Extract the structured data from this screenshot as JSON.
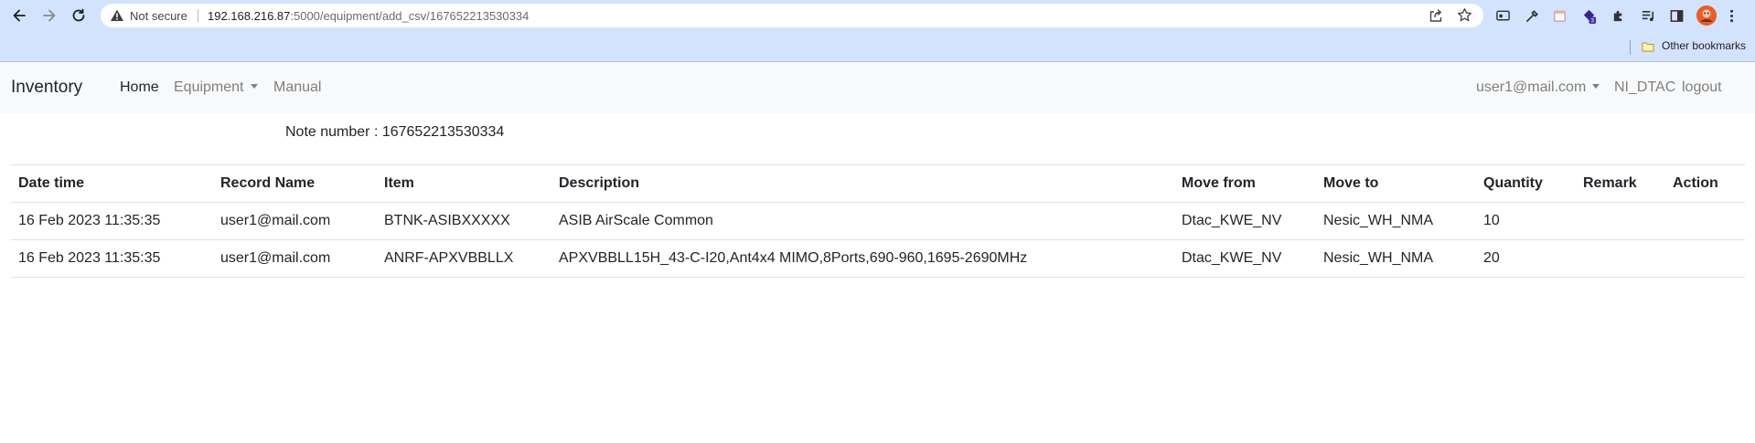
{
  "browser": {
    "security_label": "Not secure",
    "url_host": "192.168.216.87",
    "url_rest": ":5000/equipment/add_csv/167652213530334",
    "extension_badge": "3",
    "bookmarks": {
      "other_label": "Other bookmarks"
    }
  },
  "navbar": {
    "brand": "Inventory",
    "home": "Home",
    "equipment": "Equipment",
    "manual": "Manual",
    "user": "user1@mail.com",
    "group": "NI_DTAC",
    "logout": "logout"
  },
  "note": {
    "label": "Note number : ",
    "value": "167652213530334"
  },
  "table": {
    "headers": [
      "Date time",
      "Record Name",
      "Item",
      "Description",
      "Move from",
      "Move to",
      "Quantity",
      "Remark",
      "Action"
    ],
    "rows": [
      [
        "16 Feb 2023 11:35:35",
        "user1@mail.com",
        "BTNK-ASIBXXXXX",
        "ASIB AirScale Common",
        "Dtac_KWE_NV",
        "Nesic_WH_NMA",
        "10",
        "",
        ""
      ],
      [
        "16 Feb 2023 11:35:35",
        "user1@mail.com",
        "ANRF-APXVBBLLX",
        "APXVBBLL15H_43-C-I20,Ant4x4 MIMO,8Ports,690-960,1695-2690MHz",
        "Dtac_KWE_NV",
        "Nesic_WH_NMA",
        "20",
        "",
        ""
      ]
    ]
  },
  "colors": {
    "chrome_bg": "#d3e3fd",
    "navbar_bg": "#f8f9fa",
    "text": "#212529",
    "muted_link": "#7f7f7f",
    "table_border": "#dee2e6"
  }
}
